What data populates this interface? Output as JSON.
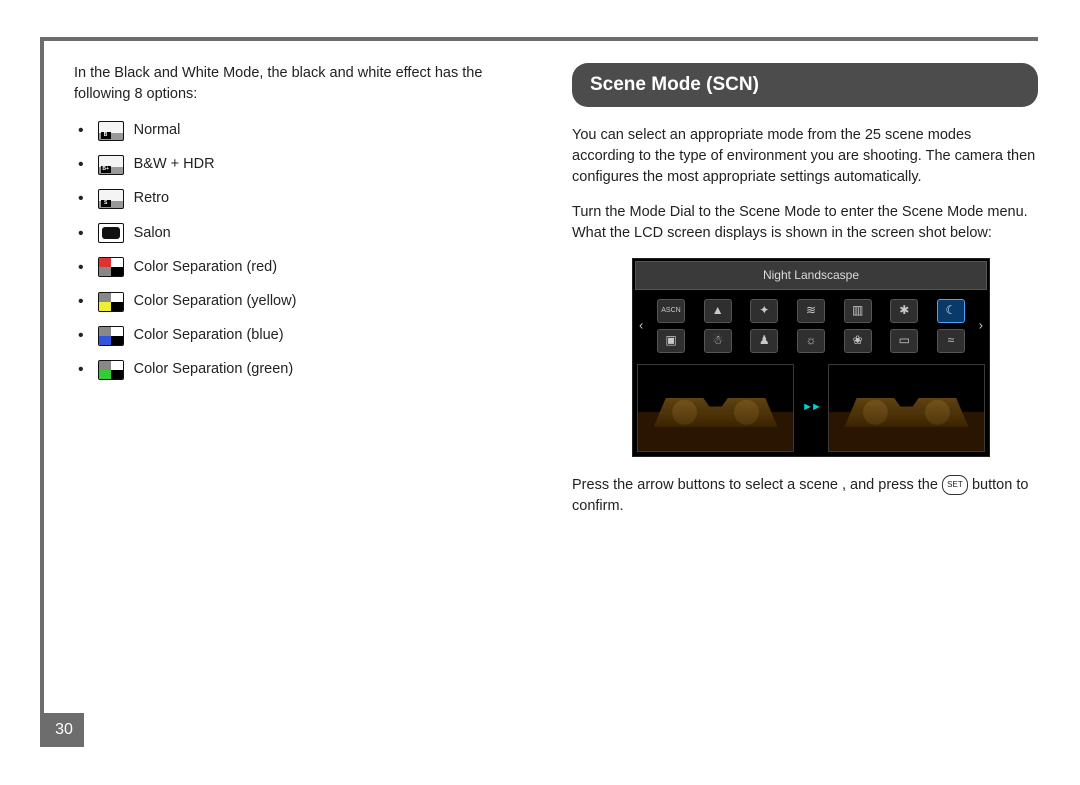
{
  "page_number": "30",
  "left": {
    "intro": "In the Black and White Mode, the black and white effect has the following 8 options:",
    "options": [
      {
        "label": "Normal",
        "icon_tag": "B"
      },
      {
        "label": "B&W + HDR",
        "icon_tag": "B+"
      },
      {
        "label": "Retro",
        "icon_tag": "S"
      },
      {
        "label": "Salon",
        "icon_tag": ""
      },
      {
        "label": "Color Separation (red)",
        "colors": [
          "#d33",
          "#fff",
          "#888",
          "#000"
        ]
      },
      {
        "label": "Color Separation (yellow)",
        "colors": [
          "#888",
          "#fff",
          "#ee3",
          "#000"
        ]
      },
      {
        "label": "Color Separation (blue)",
        "colors": [
          "#888",
          "#fff",
          "#35d",
          "#000"
        ]
      },
      {
        "label": "Color Separation (green)",
        "colors": [
          "#888",
          "#fff",
          "#3c3",
          "#000"
        ]
      }
    ]
  },
  "right": {
    "header": "Scene Mode (SCN)",
    "p1": "You can select an appropriate mode from the 25 scene modes according to the type of environment you are shooting. The camera then configures the most appropriate settings automatically.",
    "p2": "Turn the Mode Dial to the Scene Mode to enter the Scene Mode menu. What the LCD screen displays is shown in the screen shot below:",
    "lcd_title": "Night Landscaspe",
    "set_label": "SET",
    "p3_a": "Press the arrow buttons to select a scene , and press the ",
    "p3_b": " button to confirm.",
    "scene_row1": [
      "ASCN",
      "▲",
      "✦",
      "≋",
      "▥",
      "✱",
      "☾"
    ],
    "scene_row2": [
      "▣",
      "☃",
      "♟",
      "☼",
      "❀",
      "▭",
      "≈"
    ]
  }
}
